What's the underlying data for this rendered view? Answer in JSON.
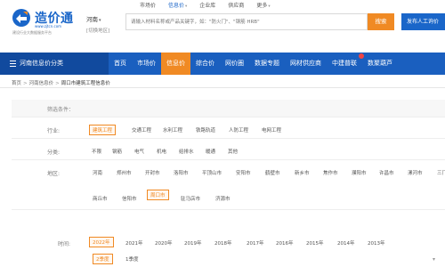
{
  "brand": {
    "name": "造价通",
    "url": "www.zjtcn.com",
    "slogan": "建设行业大数据服务平台",
    "colors": {
      "primary": "#1a66c9",
      "accent": "#f08a24",
      "nav": "#1a5fbf"
    }
  },
  "region": {
    "current": "河南",
    "switch_label": "[切换地区]"
  },
  "topnav": [
    {
      "label": "市场价",
      "dropdown": false
    },
    {
      "label": "信息价",
      "dropdown": true,
      "active": true
    },
    {
      "label": "企业库",
      "dropdown": false
    },
    {
      "label": "供应商",
      "dropdown": false
    },
    {
      "label": "更多",
      "dropdown": true
    }
  ],
  "search": {
    "placeholder": "请输入材料名称或产品关键字，如：\"防火门\"、\"钢筋 HRB\"",
    "button_label": "搜索"
  },
  "publish_button": "发布人工询价",
  "navbar": {
    "category_label": "河南信息价分类",
    "items": [
      {
        "label": "首页"
      },
      {
        "label": "市场价"
      },
      {
        "label": "信息价",
        "active": true
      },
      {
        "label": "综合价"
      },
      {
        "label": "网价圈"
      },
      {
        "label": "数据专题"
      },
      {
        "label": "网材供应商"
      },
      {
        "label": "中建普联",
        "hot": true
      },
      {
        "label": "数聚葫芦"
      }
    ]
  },
  "breadcrumb": [
    "首页",
    "河南信息价",
    "周口市建筑工程信息价"
  ],
  "filters": {
    "head_label": "筛选条件：",
    "industry": {
      "label": "行业:",
      "options": [
        "建筑工程",
        "交通工程",
        "水利工程",
        "铁路轨道",
        "人防工程",
        "电网工程"
      ],
      "selected": "建筑工程"
    },
    "category": {
      "label": "分类:",
      "options": [
        "不限",
        "钢筋",
        "电气",
        "机电",
        "给排水",
        "暖通",
        "其他"
      ]
    },
    "area": {
      "label": "地区:",
      "row1": [
        "河南",
        "郑州市",
        "开封市",
        "洛阳市",
        "平顶山市",
        "安阳市",
        "鹤壁市",
        "新乡市",
        "焦作市",
        "濮阳市",
        "许昌市",
        "漯河市",
        "三门"
      ],
      "row2": [
        "商丘市",
        "信阳市",
        "周口市",
        "驻马店市",
        "济源市"
      ],
      "selected": "周口市"
    },
    "time": {
      "label": "时间:",
      "years": [
        "2022年",
        "2021年",
        "2020年",
        "2019年",
        "2018年",
        "2017年",
        "2016年",
        "2015年",
        "2014年",
        "2013年"
      ],
      "selected": "2022年",
      "quarters": [
        "2季度",
        "1季度"
      ],
      "selected_quarter": "2季度"
    }
  }
}
